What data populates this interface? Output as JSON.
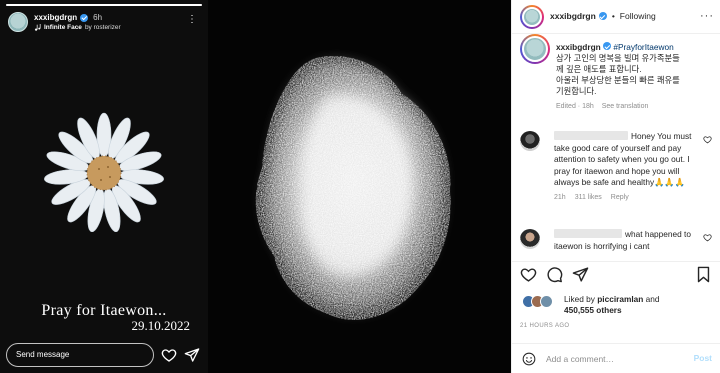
{
  "story": {
    "username": "xxxibgdrgn",
    "time": "6h",
    "music_song": "Infinite Face",
    "music_by": "by rosterizer",
    "caption": "Pray for Itaewon...",
    "date": "29.10.2022",
    "send_message_placeholder": "Send message",
    "progress": 1.0
  },
  "post_header": {
    "username": "xxxibgdrgn",
    "dot": "•",
    "follow_label": "Following",
    "more_label": "···"
  },
  "caption": {
    "username": "xxxibgdrgn",
    "hashtag": "#PrayforItaewon",
    "lines": [
      "삼가 고인의 명복을 빌며 유가족분들",
      "께 깊은 애도를 표합니다.",
      "아울러 부상당한 분들의 빠른 쾌유를",
      "기원합니다."
    ],
    "edited": "Edited · 18h",
    "see_translation": "See translation"
  },
  "comments": [
    {
      "first_word": "Honey",
      "rest": "You must take good care of yourself and pay attention to safety when you go out. I pray for itaewon and hope you will always be safe and healthy🙏🙏🙏",
      "time": "21h",
      "likes": "311 likes",
      "reply": "Reply"
    },
    {
      "first_word": "what happened to",
      "rest": "itaewon is horrifying i cant",
      "time": "",
      "likes": "",
      "reply": ""
    }
  ],
  "likes": {
    "prefix": "Liked by",
    "user": "picciramlan",
    "and": "and",
    "count": "450,555 others"
  },
  "timestamp": "21 HOURS AGO",
  "comment_box": {
    "placeholder": "Add a comment…",
    "post_label": "Post"
  },
  "colors": {
    "link_blue": "#00376b",
    "verified": "#3897f0",
    "post_disabled": "#b2dffc"
  }
}
